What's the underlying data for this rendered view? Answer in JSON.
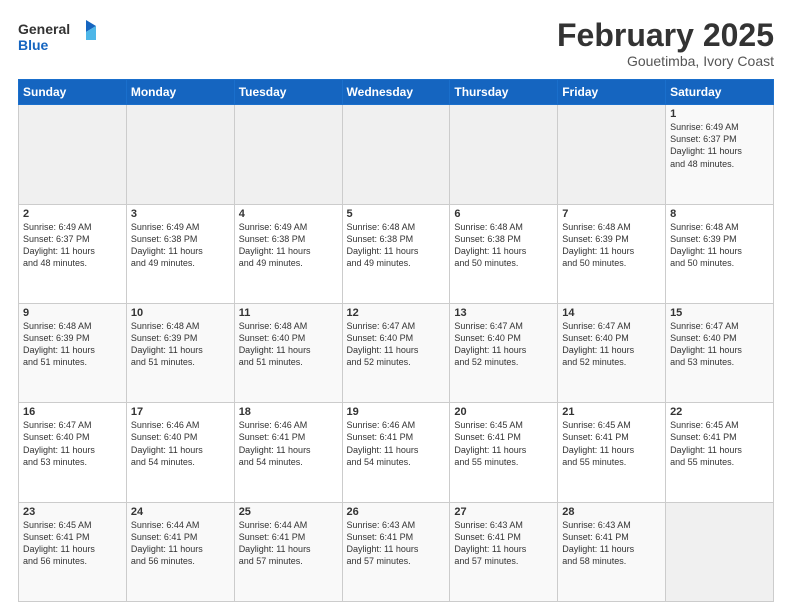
{
  "header": {
    "logo_line1": "General",
    "logo_line2": "Blue",
    "title": "February 2025",
    "subtitle": "Gouetimba, Ivory Coast"
  },
  "days_of_week": [
    "Sunday",
    "Monday",
    "Tuesday",
    "Wednesday",
    "Thursday",
    "Friday",
    "Saturday"
  ],
  "weeks": [
    [
      {
        "day": "",
        "info": ""
      },
      {
        "day": "",
        "info": ""
      },
      {
        "day": "",
        "info": ""
      },
      {
        "day": "",
        "info": ""
      },
      {
        "day": "",
        "info": ""
      },
      {
        "day": "",
        "info": ""
      },
      {
        "day": "1",
        "info": "Sunrise: 6:49 AM\nSunset: 6:37 PM\nDaylight: 11 hours\nand 48 minutes."
      }
    ],
    [
      {
        "day": "2",
        "info": "Sunrise: 6:49 AM\nSunset: 6:37 PM\nDaylight: 11 hours\nand 48 minutes."
      },
      {
        "day": "3",
        "info": "Sunrise: 6:49 AM\nSunset: 6:38 PM\nDaylight: 11 hours\nand 49 minutes."
      },
      {
        "day": "4",
        "info": "Sunrise: 6:49 AM\nSunset: 6:38 PM\nDaylight: 11 hours\nand 49 minutes."
      },
      {
        "day": "5",
        "info": "Sunrise: 6:48 AM\nSunset: 6:38 PM\nDaylight: 11 hours\nand 49 minutes."
      },
      {
        "day": "6",
        "info": "Sunrise: 6:48 AM\nSunset: 6:38 PM\nDaylight: 11 hours\nand 50 minutes."
      },
      {
        "day": "7",
        "info": "Sunrise: 6:48 AM\nSunset: 6:39 PM\nDaylight: 11 hours\nand 50 minutes."
      },
      {
        "day": "8",
        "info": "Sunrise: 6:48 AM\nSunset: 6:39 PM\nDaylight: 11 hours\nand 50 minutes."
      }
    ],
    [
      {
        "day": "9",
        "info": "Sunrise: 6:48 AM\nSunset: 6:39 PM\nDaylight: 11 hours\nand 51 minutes."
      },
      {
        "day": "10",
        "info": "Sunrise: 6:48 AM\nSunset: 6:39 PM\nDaylight: 11 hours\nand 51 minutes."
      },
      {
        "day": "11",
        "info": "Sunrise: 6:48 AM\nSunset: 6:40 PM\nDaylight: 11 hours\nand 51 minutes."
      },
      {
        "day": "12",
        "info": "Sunrise: 6:47 AM\nSunset: 6:40 PM\nDaylight: 11 hours\nand 52 minutes."
      },
      {
        "day": "13",
        "info": "Sunrise: 6:47 AM\nSunset: 6:40 PM\nDaylight: 11 hours\nand 52 minutes."
      },
      {
        "day": "14",
        "info": "Sunrise: 6:47 AM\nSunset: 6:40 PM\nDaylight: 11 hours\nand 52 minutes."
      },
      {
        "day": "15",
        "info": "Sunrise: 6:47 AM\nSunset: 6:40 PM\nDaylight: 11 hours\nand 53 minutes."
      }
    ],
    [
      {
        "day": "16",
        "info": "Sunrise: 6:47 AM\nSunset: 6:40 PM\nDaylight: 11 hours\nand 53 minutes."
      },
      {
        "day": "17",
        "info": "Sunrise: 6:46 AM\nSunset: 6:40 PM\nDaylight: 11 hours\nand 54 minutes."
      },
      {
        "day": "18",
        "info": "Sunrise: 6:46 AM\nSunset: 6:41 PM\nDaylight: 11 hours\nand 54 minutes."
      },
      {
        "day": "19",
        "info": "Sunrise: 6:46 AM\nSunset: 6:41 PM\nDaylight: 11 hours\nand 54 minutes."
      },
      {
        "day": "20",
        "info": "Sunrise: 6:45 AM\nSunset: 6:41 PM\nDaylight: 11 hours\nand 55 minutes."
      },
      {
        "day": "21",
        "info": "Sunrise: 6:45 AM\nSunset: 6:41 PM\nDaylight: 11 hours\nand 55 minutes."
      },
      {
        "day": "22",
        "info": "Sunrise: 6:45 AM\nSunset: 6:41 PM\nDaylight: 11 hours\nand 55 minutes."
      }
    ],
    [
      {
        "day": "23",
        "info": "Sunrise: 6:45 AM\nSunset: 6:41 PM\nDaylight: 11 hours\nand 56 minutes."
      },
      {
        "day": "24",
        "info": "Sunrise: 6:44 AM\nSunset: 6:41 PM\nDaylight: 11 hours\nand 56 minutes."
      },
      {
        "day": "25",
        "info": "Sunrise: 6:44 AM\nSunset: 6:41 PM\nDaylight: 11 hours\nand 57 minutes."
      },
      {
        "day": "26",
        "info": "Sunrise: 6:43 AM\nSunset: 6:41 PM\nDaylight: 11 hours\nand 57 minutes."
      },
      {
        "day": "27",
        "info": "Sunrise: 6:43 AM\nSunset: 6:41 PM\nDaylight: 11 hours\nand 57 minutes."
      },
      {
        "day": "28",
        "info": "Sunrise: 6:43 AM\nSunset: 6:41 PM\nDaylight: 11 hours\nand 58 minutes."
      },
      {
        "day": "",
        "info": ""
      }
    ]
  ]
}
